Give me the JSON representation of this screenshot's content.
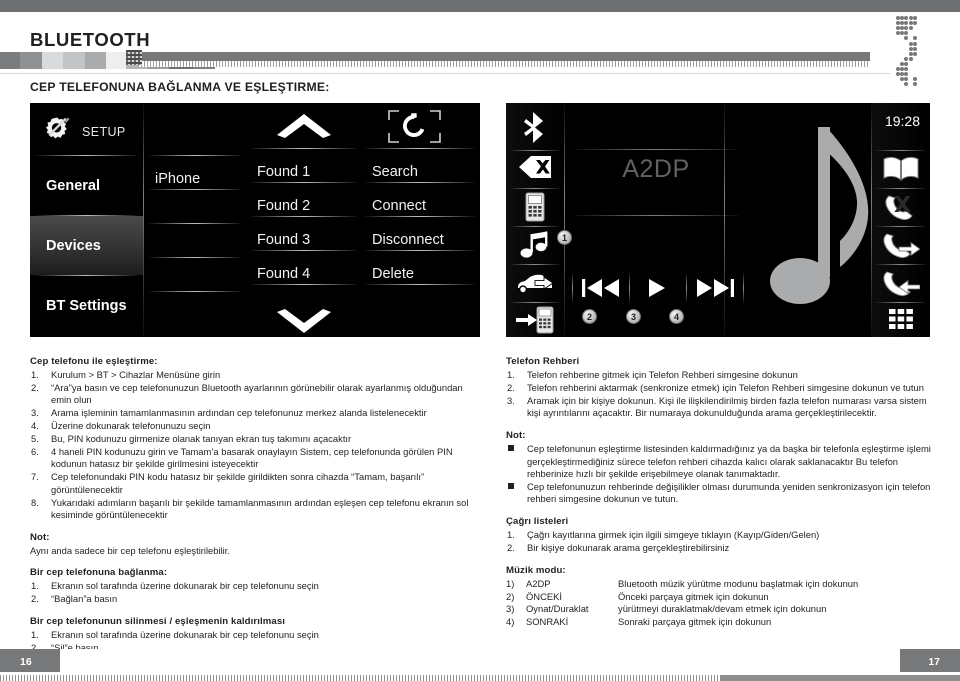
{
  "header": {
    "title": "BLUETOOTH",
    "section_title": "CEP TELEFONUNA BAĞLANMA VE EŞLEŞTIRME:"
  },
  "device_setup": {
    "setup_label": "SETUP",
    "gear_icon": "gear-screwdriver-icon",
    "menu": [
      {
        "label": "General",
        "active": false
      },
      {
        "label": "Devices",
        "active": true
      },
      {
        "label": "BT Settings",
        "active": false
      }
    ],
    "paired_list": [
      "iPhone"
    ],
    "found_list": [
      "Found 1",
      "Found 2",
      "Found 3",
      "Found 4"
    ],
    "actions": [
      "Search",
      "Connect",
      "Disconnect",
      "Delete"
    ],
    "scroll_up_icon": "chevron-up-icon",
    "scroll_down_icon": "chevron-down-icon",
    "refresh_icon": "refresh-rotate-icon"
  },
  "device_a2dp": {
    "clock": "19:28",
    "mode_label": "A2DP",
    "left_rail_icons": [
      "bluetooth-icon",
      "end-call-icon",
      "dialpad-phone-icon",
      "music-note-icon",
      "car-back-icon",
      "transfer-to-phone-icon"
    ],
    "right_rail_icons": [
      "phonebook-icon",
      "missed-call-icon",
      "outgoing-call-icon",
      "incoming-call-icon",
      "keypad-grid-icon"
    ],
    "transport_icons": [
      "previous-track-icon",
      "play-icon",
      "next-track-icon"
    ],
    "callout_badges": [
      "1",
      "2",
      "3",
      "4"
    ],
    "artwork_icon": "music-note-artwork"
  },
  "left_column": {
    "pairing_heading": "Cep telefonu ile eşleştirme:",
    "pairing_steps": [
      "Kurulum > BT > Cihazlar Menüsüne girin",
      "“Ara”ya basın ve cep telefonunuzun Bluetooth ayarlarının görünebilir olarak ayarlanmış olduğundan emin olun",
      "Arama işleminin tamamlanmasının ardından cep telefonunuz merkez alanda listelenecektir",
      "Üzerine dokunarak telefonunuzu seçin",
      "Bu, PIN kodunuzu girmenize olanak tanıyan ekran tuş takımını açacaktır",
      "4 haneli PIN kodunuzu girin ve Tamam’a basarak onaylayın Sistem, cep telefonunda görülen PIN kodunun hatasız bir şekilde girilmesini isteyecektir",
      "Cep telefonundaki PIN kodu hatasız bir şekilde girildikten sonra cihazda “Tamam, başarılı” görüntülenecektir",
      "Yukarıdaki adımların başarılı bir şekilde tamamlanmasının ardından eşleşen cep telefonu ekranın sol kesiminde görüntülenecektir"
    ],
    "note_heading": "Not:",
    "note_text": "Aynı anda sadece bir cep telefonu eşleştirilebilir.",
    "connect_heading": "Bir cep telefonuna bağlanma:",
    "connect_steps": [
      "Ekranın sol tarafında üzerine dokunarak bir cep telefonunu seçin",
      "“Bağlan”a basın"
    ],
    "delete_heading": "Bir cep telefonunun silinmesi / eşleşmenin kaldırılması",
    "delete_steps": [
      "Ekranın sol tarafında üzerine dokunarak bir cep telefonunu seçin",
      "“Sil”e basın."
    ]
  },
  "right_column": {
    "phonebook_heading": "Telefon Rehberi",
    "phonebook_steps": [
      "Telefon rehberine gitmek için Telefon Rehberi simgesine dokunun",
      "Telefon rehberini aktarmak (senkronize etmek) için Telefon Rehberi simgesine dokunun ve tutun",
      "Aramak için bir kişiye dokunun. Kişi ile ilişkilendirilmiş birden fazla telefon numarası varsa sistem kişi ayrıntılarını açacaktır. Bir numaraya dokunulduğunda arama gerçekleştirilecektir."
    ],
    "note_heading": "Not:",
    "note_bullets": [
      "Cep telefonunun eşleştirme listesinden kaldırmadığınız ya da başka bir telefonla eşleştirme işlemi gerçekleştirmediğiniz sürece telefon rehberi cihazda kalıcı olarak saklanacaktır Bu telefon rehberinize hızlı bir şekilde erişebilmeye olanak tanımaktadır.",
      "Cep telefonunuzun rehberinde değişilikler olması durumunda yeniden senkronizasyon için telefon rehberi simgesine dokunun ve tutun."
    ],
    "call_heading": "Çağrı listeleri",
    "call_steps": [
      "Çağrı kayıtlarına girmek için ilgili simgeye tıklayın (Kayıp/Giden/Gelen)",
      "Bir kişiye dokunarak arama gerçekleştirebilirsiniz"
    ],
    "music_heading": "Müzik modu:",
    "music_rows": [
      {
        "num": "1)",
        "key": "A2DP",
        "desc": "Bluetooth müzik yürütme modunu başlatmak için dokunun"
      },
      {
        "num": "2)",
        "key": "ÖNCEKİ",
        "desc": "Önceki parçaya gitmek için dokunun"
      },
      {
        "num": "3)",
        "key": "Oynat/Duraklat",
        "desc": "yürütmeyi duraklatmak/devam etmek için dokunun"
      },
      {
        "num": "4)",
        "key": "SONRAKİ",
        "desc": "Sonraki parçaya gitmek için dokunun"
      }
    ]
  },
  "footer": {
    "page_left": "16",
    "page_right": "17"
  },
  "colors": {
    "accent_grey": "#77787a",
    "text": "#231f20",
    "screen_bg": "#000000"
  }
}
